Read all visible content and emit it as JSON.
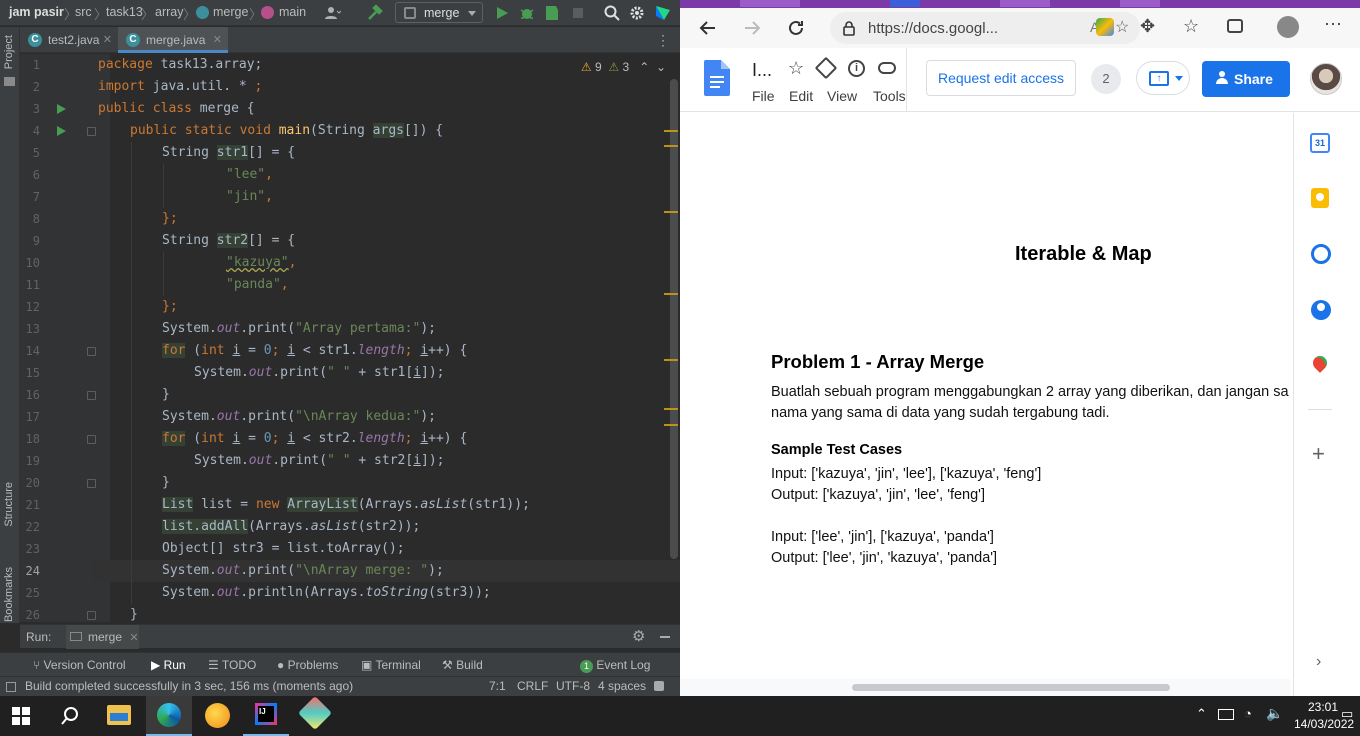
{
  "ide": {
    "breadcrumb": [
      "jam pasir",
      "src",
      "task13",
      "array",
      "merge",
      "main"
    ],
    "run_config": "merge",
    "tabs": [
      {
        "label": "test2.java",
        "active": false
      },
      {
        "label": "merge.java",
        "active": true
      }
    ],
    "inspections": {
      "warnings": "9",
      "weak_warnings": "3"
    },
    "left_panels": [
      "Project",
      "Structure",
      "Bookmarks"
    ],
    "line_numbers": [
      "1",
      "2",
      "3",
      "4",
      "5",
      "6",
      "7",
      "8",
      "9",
      "10",
      "11",
      "12",
      "13",
      "14",
      "15",
      "16",
      "17",
      "18",
      "19",
      "20",
      "21",
      "22",
      "23",
      "24",
      "25",
      "26"
    ],
    "current_line": "24",
    "run_panel": {
      "label": "Run:",
      "tab": "merge"
    },
    "tool_windows": [
      "Version Control",
      "Run",
      "TODO",
      "Problems",
      "Terminal",
      "Build"
    ],
    "event_log": {
      "count": "1",
      "label": "Event Log"
    },
    "status": {
      "message": "Build completed successfully in 3 sec, 156 ms (moments ago)",
      "position": "7:1",
      "line_sep": "CRLF",
      "encoding": "UTF-8",
      "indent": "4 spaces"
    },
    "code": {
      "l1": [
        "package",
        " task13.array;"
      ],
      "l2": [
        "import",
        " java.util. * ",
        ";"
      ],
      "l3": [
        "public",
        " ",
        "class",
        " merge {"
      ],
      "l4": [
        "public",
        " ",
        "static",
        " ",
        "void",
        " ",
        "main",
        "(String ",
        "args",
        "[]) {"
      ],
      "l5": [
        "String ",
        "str1",
        "[] = {"
      ],
      "l6": "\"lee\"",
      "l6b": ",",
      "l7": "\"jin\"",
      "l7b": ",",
      "l8": [
        "};"
      ],
      "l9": [
        "String ",
        "str2",
        "[] = {"
      ],
      "l10": "\"kazuya\"",
      "l10b": ",",
      "l11": "\"panda\"",
      "l11b": ",",
      "l12": [
        "};"
      ],
      "l13": [
        "System.",
        "out",
        ".print(",
        "\"Array pertama:\"",
        ");"
      ],
      "l14": [
        "for",
        " (",
        "int",
        " ",
        "i",
        " = ",
        "0",
        "; ",
        "i",
        " < str1.",
        "length",
        "; ",
        "i",
        "++) {"
      ],
      "l15": [
        "System.",
        "out",
        ".print(",
        "\" \"",
        " + str1[",
        "i",
        "]);"
      ],
      "l16": [
        "}"
      ],
      "l17": [
        "System.",
        "out",
        ".print(",
        "\"\\nArray kedua:\"",
        ");"
      ],
      "l18": [
        "for",
        " (",
        "int",
        " ",
        "i",
        " = ",
        "0",
        "; ",
        "i",
        " < str2.",
        "length",
        "; ",
        "i",
        "++) {"
      ],
      "l19": [
        "System.",
        "out",
        ".print(",
        "\" \"",
        " + str2[",
        "i",
        "]);"
      ],
      "l20": [
        "}"
      ],
      "l21": [
        "List",
        " list = ",
        "new",
        " ",
        "ArrayList",
        "(Arrays.",
        "asList",
        "(str1));"
      ],
      "l22": [
        "list.addAll",
        "(Arrays.",
        "asList",
        "(str2));"
      ],
      "l23": [
        "Object[] str3 = list.toArray();"
      ],
      "l24": [
        "System.",
        "out",
        ".print(",
        "\"\\nArray merge: \"",
        ");"
      ],
      "l25": [
        "System.",
        "out",
        ".println(Arrays.",
        "toString",
        "(str3));"
      ],
      "l26": [
        "}"
      ]
    }
  },
  "browser": {
    "url": "https://docs.googl...",
    "doc_title_short": "I...",
    "menu": [
      "File",
      "Edit",
      "View",
      "Tools"
    ],
    "request_edit": "Request edit access",
    "viewer_count": "2",
    "share": "Share",
    "doc": {
      "title": "Iterable & Map",
      "problem_heading": "Problem 1 - Array Merge",
      "para_line1": "Buatlah sebuah program menggabungkan 2 array yang diberikan, dan jangan sa",
      "para_line2": "nama yang sama di data yang sudah tergabung tadi.",
      "sample_heading": "Sample Test Cases",
      "cases": [
        {
          "input": "Input: ['kazuya', 'jin', 'lee'], ['kazuya', 'feng']",
          "output": "Output: ['kazuya', 'jin', 'lee', 'feng']"
        },
        {
          "input": "Input: ['lee', 'jin'], ['kazuya', 'panda']",
          "output": "Output: ['lee', 'jin', 'kazuya', 'panda']"
        }
      ]
    },
    "sidebar_icons": [
      "calendar-icon",
      "keep-icon",
      "tasks-icon",
      "contacts-icon",
      "maps-icon",
      "add-icon"
    ],
    "calendar_day": "31"
  },
  "taskbar": {
    "time": "23:01",
    "date": "14/03/2022"
  },
  "colors": {
    "ide_bg": "#2b2b2b",
    "keyword": "#cc7832",
    "string": "#6a8759",
    "number": "#6897bb",
    "field": "#9876aa",
    "method": "#ffc66d",
    "share_blue": "#1a73e8"
  }
}
